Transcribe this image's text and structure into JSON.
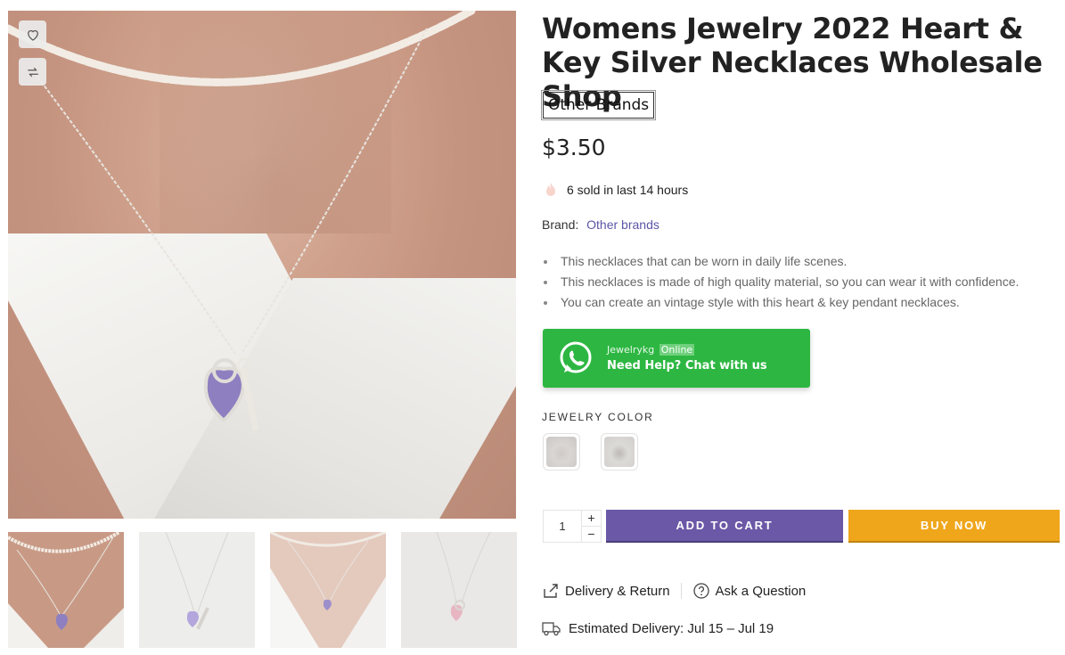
{
  "product": {
    "title": "Womens Jewelry 2022 Heart & Key Silver Necklaces Wholesale Shop",
    "brand_badge": "Other Brands",
    "price": "$3.50",
    "sold_text": "6 sold in last 14 hours",
    "brand_label": "Brand:",
    "brand_link": "Other brands",
    "features": [
      "This necklaces that can be worn in daily life scenes.",
      "This necklaces is made of high quality material, so you can wear it with confidence.",
      "You can create an vintage style with this heart & key pendant necklaces."
    ]
  },
  "chat": {
    "name": "Jewelrykg",
    "status": "Online",
    "cta": "Need Help? Chat with us",
    "color": "#2db742"
  },
  "variant": {
    "label": "JEWELRY COLOR",
    "swatches": [
      "silver-with-pearl",
      "silver"
    ]
  },
  "purchase": {
    "quantity": "1",
    "plus": "+",
    "minus": "−",
    "add_to_cart": "ADD TO CART",
    "buy_now": "BUY NOW",
    "cart_color": "#6b58a6",
    "buy_color": "#efa61b"
  },
  "links": {
    "delivery_return": "Delivery & Return",
    "ask_question": "Ask a Question",
    "estimated_delivery": "Estimated Delivery: Jul 15 – Jul 19"
  },
  "gallery": {
    "icons": [
      "heart-icon",
      "compare-icon"
    ],
    "thumbnail_count": 4
  }
}
